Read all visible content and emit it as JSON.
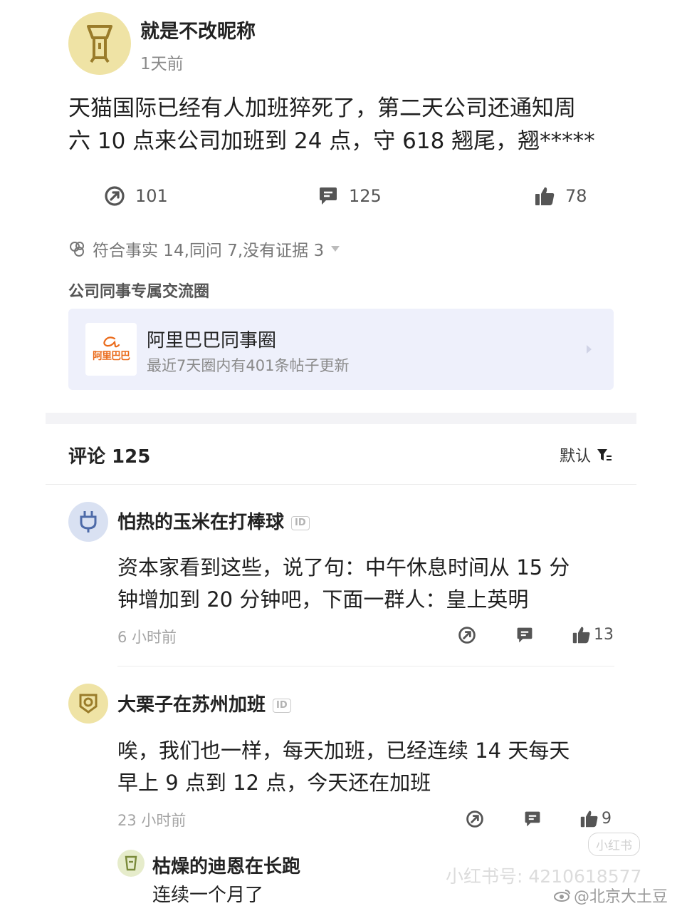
{
  "post": {
    "author": "就是不改昵称",
    "time": "1天前",
    "content_line1": "天猫国际已经有人加班猝死了，第二天公司还通知周",
    "content_line2": "六 10 点来公司加班到 24 点，守 618 翘尾，翘*****",
    "stats": {
      "shares": "101",
      "comments": "125",
      "likes": "78"
    },
    "reactions": "符合事实 14,同问 7,没有证据 3",
    "circle_section_title": "公司同事专属交流圈",
    "circle": {
      "logo_text": "阿里巴巴",
      "name": "阿里巴巴同事圈",
      "desc": "最近7天圈内有401条帖子更新"
    }
  },
  "comments_header": {
    "title": "评论 125",
    "sort": "默认"
  },
  "comments": [
    {
      "user": "怕热的玉米在打棒球",
      "badge": "ID",
      "line1": "资本家看到这些，说了句：中午休息时间从 15 分",
      "line2": "钟增加到 20 分钟吧，下面一群人：皇上英明",
      "time": "6 小时前",
      "likes": "13"
    },
    {
      "user": "大栗子在苏州加班",
      "badge": "ID",
      "line1": "唉，我们也一样，每天加班，已经连续 14 天每天",
      "line2": "早上 9 点到 12 点，今天还在加班",
      "time": "23 小时前",
      "likes": "9"
    }
  ],
  "reply": {
    "user": "枯燥的迪恩在长跑",
    "text": "连续一个月了"
  },
  "watermarks": {
    "xhs_logo": "小红书",
    "xhs_id": "小红书号: 4210618577",
    "weibo": "@北京大土豆"
  },
  "colors": {
    "avatar_yellow": "#efe3a5",
    "avatar_blue": "#d9e1f2",
    "circle_bg": "#eef0fb",
    "logo_orange": "#ea6a1a"
  }
}
